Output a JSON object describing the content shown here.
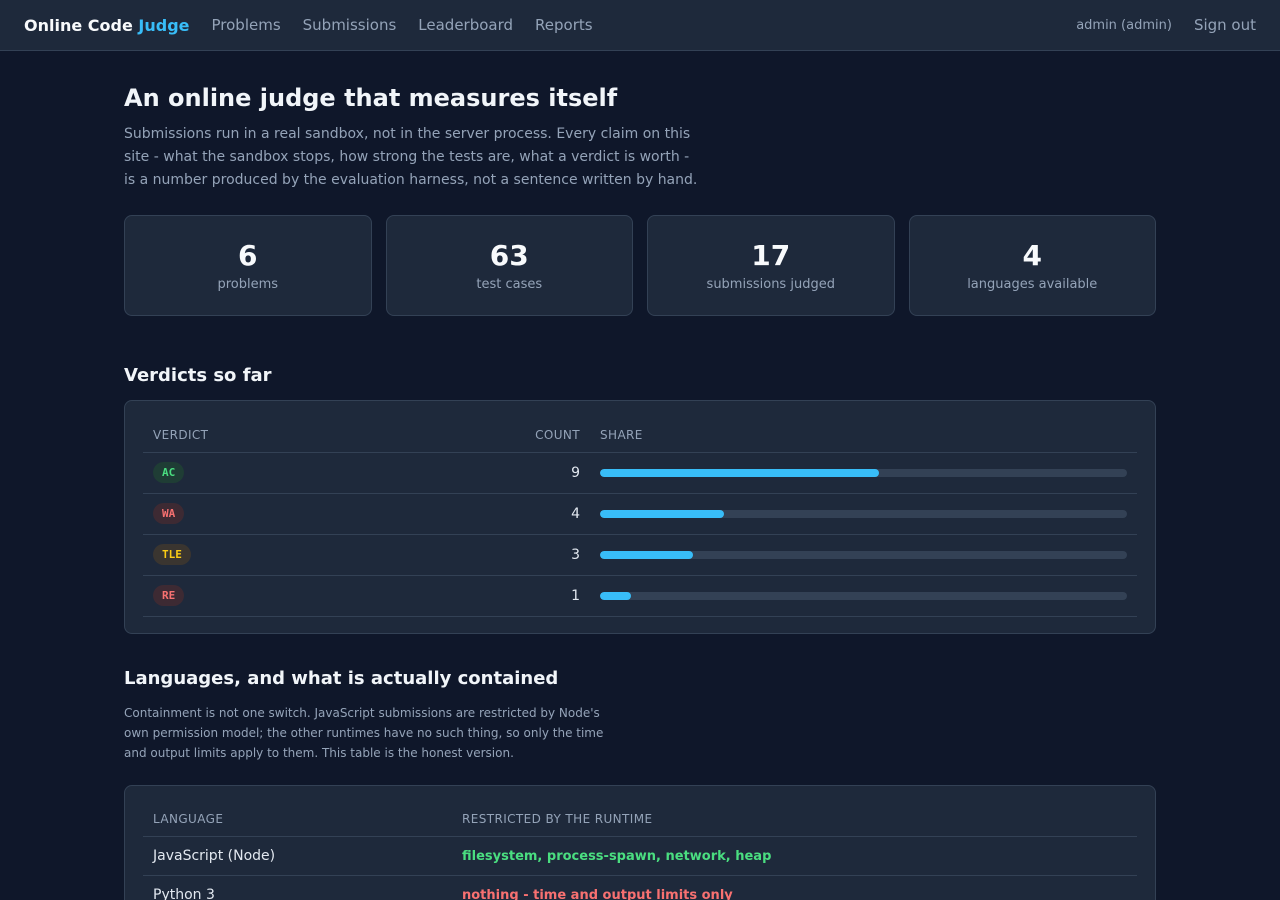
{
  "nav": {
    "brand_prefix": "Online Code ",
    "brand_accent": "Judge",
    "links": [
      "Problems",
      "Submissions",
      "Leaderboard",
      "Reports"
    ],
    "user": "admin (admin)",
    "signout": "Sign out"
  },
  "hero": {
    "title": "An online judge that measures itself",
    "text": "Submissions run in a real sandbox, not in the server process. Every claim on this site - what the sandbox stops, how strong the tests are, what a verdict is worth - is a number produced by the evaluation harness, not a sentence written by hand."
  },
  "stats": [
    {
      "value": "6",
      "label": "problems"
    },
    {
      "value": "63",
      "label": "test cases"
    },
    {
      "value": "17",
      "label": "submissions judged"
    },
    {
      "value": "4",
      "label": "languages available"
    }
  ],
  "verdicts": {
    "title": "Verdicts so far",
    "headers": {
      "verdict": "Verdict",
      "count": "Count",
      "share": "Share"
    },
    "rows": [
      {
        "verdict": "AC",
        "count": "9",
        "share": 0.53,
        "color": "#4ade80",
        "bg": "#1f3d35"
      },
      {
        "verdict": "WA",
        "count": "4",
        "share": 0.235,
        "color": "#f87171",
        "bg": "#3d2a33"
      },
      {
        "verdict": "TLE",
        "count": "3",
        "share": 0.176,
        "color": "#facc15",
        "bg": "#3a3530"
      },
      {
        "verdict": "RE",
        "count": "1",
        "share": 0.059,
        "color": "#f87171",
        "bg": "#3d2a33"
      }
    ]
  },
  "languages": {
    "title": "Languages, and what is actually contained",
    "text": "Containment is not one switch. JavaScript submissions are restricted by Node's own permission model; the other runtimes have no such thing, so only the time and output limits apply to them. This table is the honest version.",
    "headers": {
      "language": "Language",
      "restricted": "Restricted by the runtime"
    },
    "rows": [
      {
        "language": "JavaScript (Node)",
        "restricted": "filesystem, process-spawn, network, heap",
        "color": "#4ade80"
      },
      {
        "language": "Python 3",
        "restricted": "nothing - time and output limits only",
        "color": "#f87171"
      }
    ]
  }
}
